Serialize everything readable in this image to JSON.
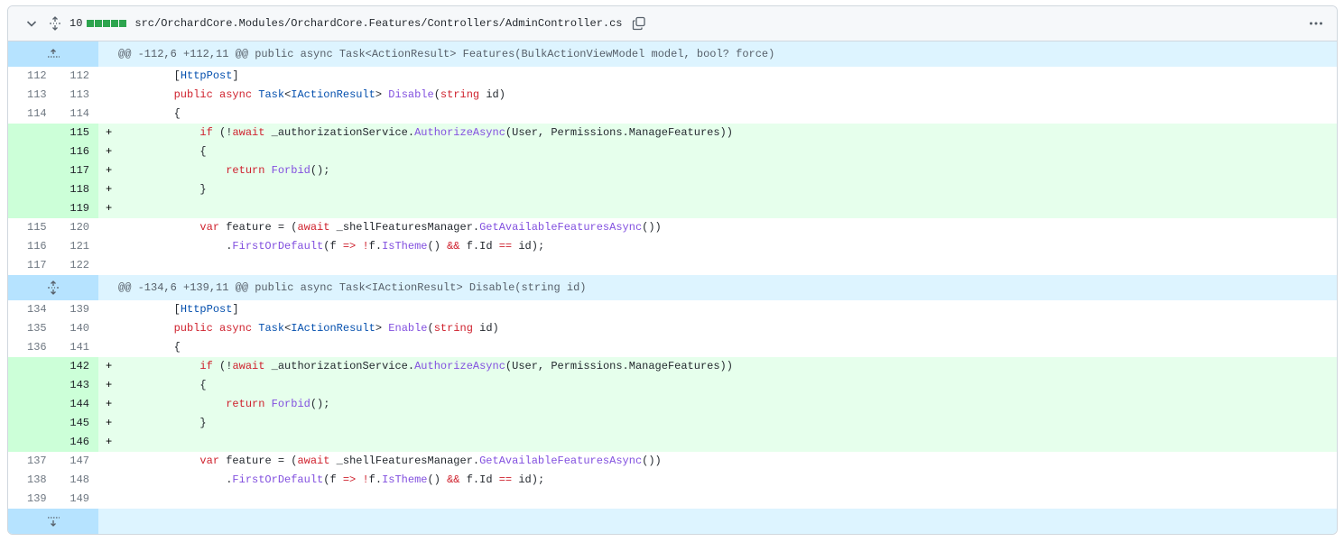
{
  "file": {
    "changes": "10",
    "path": "src/OrchardCore.Modules/OrchardCore.Features/Controllers/AdminController.cs",
    "add_color": "#2da44e",
    "icons": [
      "chevron-down-icon",
      "unfold-icon",
      "copy-icon",
      "kebab-horizontal-icon"
    ]
  },
  "hunks": [
    {
      "header": "@@ -112,6 +112,11 @@ public async Task<ActionResult> Features(BulkActionViewModel model, bool? force)",
      "expand_icon": "expand-up-icon",
      "lines": [
        {
          "old": "112",
          "new": "112",
          "sign": "",
          "type": "ctx",
          "code": "        [HttpPost]"
        },
        {
          "old": "113",
          "new": "113",
          "sign": "",
          "type": "ctx",
          "code": "        public async Task<IActionResult> Disable(string id)"
        },
        {
          "old": "114",
          "new": "114",
          "sign": "",
          "type": "ctx",
          "code": "        {"
        },
        {
          "old": "",
          "new": "115",
          "sign": "+",
          "type": "add",
          "code": "            if (!await _authorizationService.AuthorizeAsync(User, Permissions.ManageFeatures))"
        },
        {
          "old": "",
          "new": "116",
          "sign": "+",
          "type": "add",
          "code": "            {"
        },
        {
          "old": "",
          "new": "117",
          "sign": "+",
          "type": "add",
          "code": "                return Forbid();"
        },
        {
          "old": "",
          "new": "118",
          "sign": "+",
          "type": "add",
          "code": "            }"
        },
        {
          "old": "",
          "new": "119",
          "sign": "+",
          "type": "add",
          "code": ""
        },
        {
          "old": "115",
          "new": "120",
          "sign": "",
          "type": "ctx",
          "code": "            var feature = (await _shellFeaturesManager.GetAvailableFeaturesAsync())"
        },
        {
          "old": "116",
          "new": "121",
          "sign": "",
          "type": "ctx",
          "code": "                .FirstOrDefault(f => !f.IsTheme() && f.Id == id);"
        },
        {
          "old": "117",
          "new": "122",
          "sign": "",
          "type": "ctx",
          "code": ""
        }
      ]
    },
    {
      "header": "@@ -134,6 +139,11 @@ public async Task<IActionResult> Disable(string id)",
      "expand_icon": "expand-both-icon",
      "lines": [
        {
          "old": "134",
          "new": "139",
          "sign": "",
          "type": "ctx",
          "code": "        [HttpPost]"
        },
        {
          "old": "135",
          "new": "140",
          "sign": "",
          "type": "ctx",
          "code": "        public async Task<IActionResult> Enable(string id)"
        },
        {
          "old": "136",
          "new": "141",
          "sign": "",
          "type": "ctx",
          "code": "        {"
        },
        {
          "old": "",
          "new": "142",
          "sign": "+",
          "type": "add",
          "code": "            if (!await _authorizationService.AuthorizeAsync(User, Permissions.ManageFeatures))"
        },
        {
          "old": "",
          "new": "143",
          "sign": "+",
          "type": "add",
          "code": "            {"
        },
        {
          "old": "",
          "new": "144",
          "sign": "+",
          "type": "add",
          "code": "                return Forbid();"
        },
        {
          "old": "",
          "new": "145",
          "sign": "+",
          "type": "add",
          "code": "            }"
        },
        {
          "old": "",
          "new": "146",
          "sign": "+",
          "type": "add",
          "code": ""
        },
        {
          "old": "137",
          "new": "147",
          "sign": "",
          "type": "ctx",
          "code": "            var feature = (await _shellFeaturesManager.GetAvailableFeaturesAsync())"
        },
        {
          "old": "138",
          "new": "148",
          "sign": "",
          "type": "ctx",
          "code": "                .FirstOrDefault(f => !f.IsTheme() && f.Id == id);"
        },
        {
          "old": "139",
          "new": "149",
          "sign": "",
          "type": "ctx",
          "code": ""
        }
      ]
    }
  ],
  "footer_expand_icon": "expand-down-icon"
}
